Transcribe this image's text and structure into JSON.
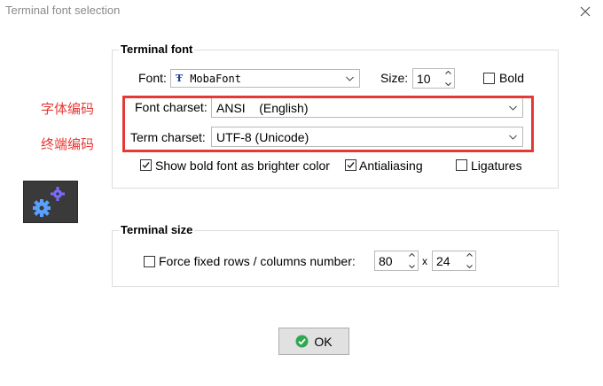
{
  "window": {
    "title": "Terminal font selection"
  },
  "terminal_font": {
    "group_title": "Terminal font",
    "font_label": "Font:",
    "font_value": "MobaFont",
    "size_label": "Size:",
    "size_value": "10",
    "bold_label": "Bold",
    "bold_checked": false,
    "font_charset_label": "Font charset:",
    "font_charset_value": "ANSI    (English)",
    "term_charset_label": "Term charset:",
    "term_charset_value": "UTF-8 (Unicode)",
    "show_bold_label": "Show bold font as brighter color",
    "show_bold_checked": true,
    "antialiasing_label": "Antialiasing",
    "antialiasing_checked": true,
    "ligatures_label": "Ligatures",
    "ligatures_checked": false
  },
  "annotations": {
    "font_charset": "字体编码",
    "term_charset": "终端编码",
    "highlight_color": "#e53935"
  },
  "terminal_size": {
    "group_title": "Terminal size",
    "force_label": "Force fixed rows / columns number:",
    "force_checked": false,
    "columns_value": "80",
    "separator": "x",
    "rows_value": "24"
  },
  "buttons": {
    "ok_label": "OK"
  },
  "icons": {
    "close": "close-icon",
    "app": "gears-icon",
    "ok": "check-circle-icon",
    "font_type": "truetype-icon"
  }
}
